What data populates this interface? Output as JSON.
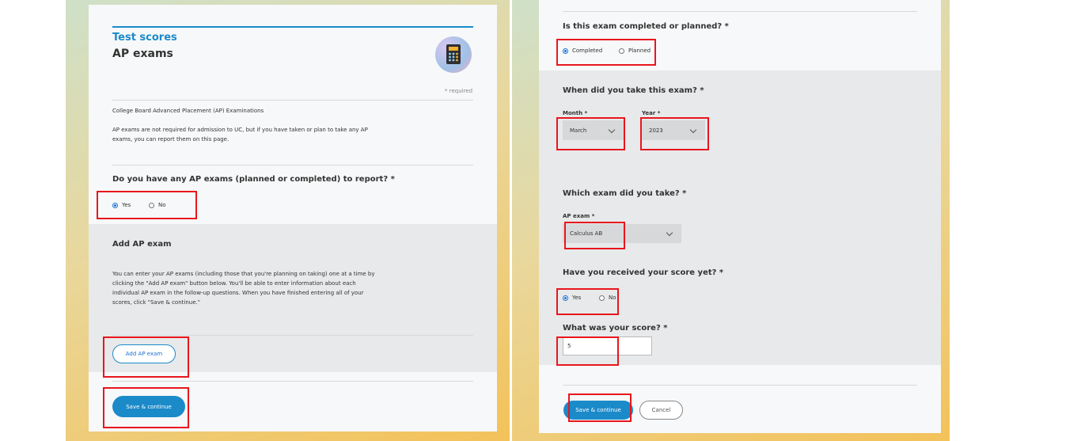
{
  "left": {
    "title": "Test scores",
    "subtitle": "AP exams",
    "required_note": "* required",
    "section_caption": "College Board Advanced Placement (AP) Examinations",
    "intro_line1": "AP exams are not required for admission to UC, but if you have taken or plan to take any AP",
    "intro_line2": "exams, you can report them on this page.",
    "question": "Do you have any AP exams (planned or completed) to report? *",
    "radio_yes": "Yes",
    "radio_no": "No",
    "add_heading": "Add AP exam",
    "add_desc1": "You can enter your AP exams (including those that you're planning on taking) one at a time by",
    "add_desc2": "clicking the \"Add AP exam\" button below. You'll be able to enter information about each",
    "add_desc3": "individual AP exam in the follow-up questions. When you have finished entering all of your",
    "add_desc4": "scores, click \"Save & continue.\"",
    "add_button": "Add AP exam",
    "save_button": "Save & continue",
    "icon": "calculator-icon"
  },
  "right": {
    "status_question": "Is this exam completed or planned? *",
    "radio_completed": "Completed",
    "radio_planned": "Planned",
    "date_question": "When did you take this exam? *",
    "month_label": "Month *",
    "month_value": "March",
    "year_label": "Year *",
    "year_value": "2023",
    "exam_question": "Which exam did you take? *",
    "exam_label": "AP exam *",
    "exam_value": "Calculus AB",
    "score_received_question": "Have you received your score yet? *",
    "radio_yes": "Yes",
    "radio_no": "No",
    "score_question": "What was your score? *",
    "score_value": "5",
    "save_button": "Save & continue",
    "cancel_button": "Cancel"
  },
  "colors": {
    "accent": "#1b8ac9",
    "highlight": "#e8161d"
  }
}
